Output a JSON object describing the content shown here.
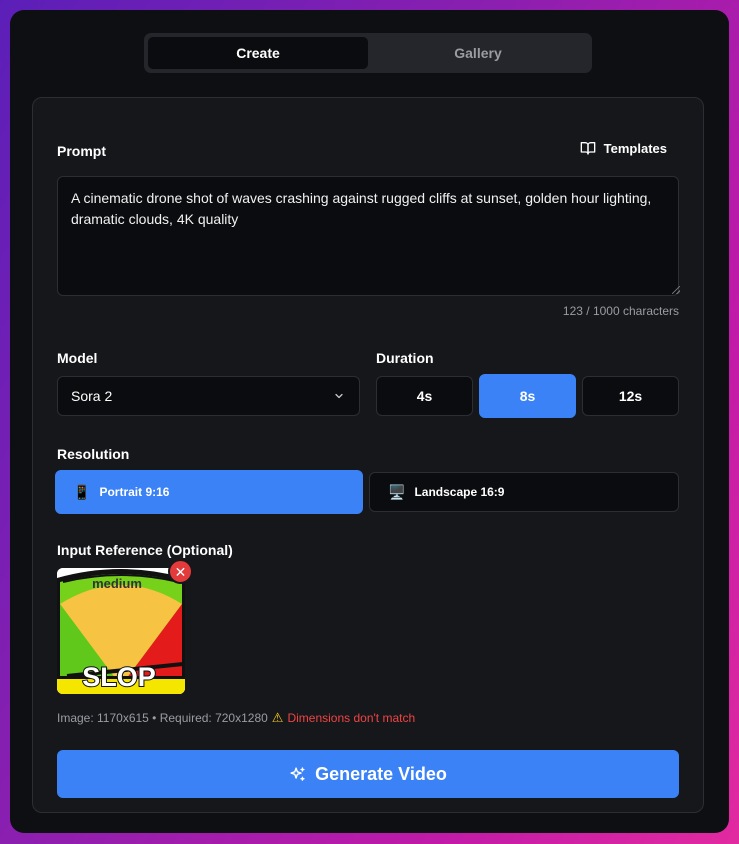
{
  "tabs": [
    {
      "label": "Create",
      "active": true
    },
    {
      "label": "Gallery",
      "active": false
    }
  ],
  "prompt": {
    "label": "Prompt",
    "templates_label": "Templates",
    "value": "A cinematic drone shot of waves crashing against rugged cliffs at sunset, golden hour lighting, dramatic clouds, 4K quality",
    "char_count": "123 / 1000 characters"
  },
  "model": {
    "label": "Model",
    "selected": "Sora 2"
  },
  "duration": {
    "label": "Duration",
    "options": [
      "4s",
      "8s",
      "12s"
    ],
    "selected": "8s"
  },
  "resolution": {
    "label": "Resolution",
    "options": [
      {
        "icon": "📱",
        "icon_name": "phone-icon",
        "label": "Portrait 9:16",
        "active": true
      },
      {
        "icon": "🖥️",
        "icon_name": "desktop-icon",
        "label": "Landscape 16:9",
        "active": false
      }
    ]
  },
  "reference": {
    "label": "Input Reference (Optional)",
    "image_text_top": "medium",
    "image_text_bottom": "SLOP",
    "info": "Image: 1170x615 • Required: 720x1280",
    "warning": "Dimensions don't match"
  },
  "generate": {
    "label": "Generate Video"
  },
  "colors": {
    "accent": "#3b82f6",
    "danger": "#ef4444",
    "warning_icon": "#facc15"
  }
}
